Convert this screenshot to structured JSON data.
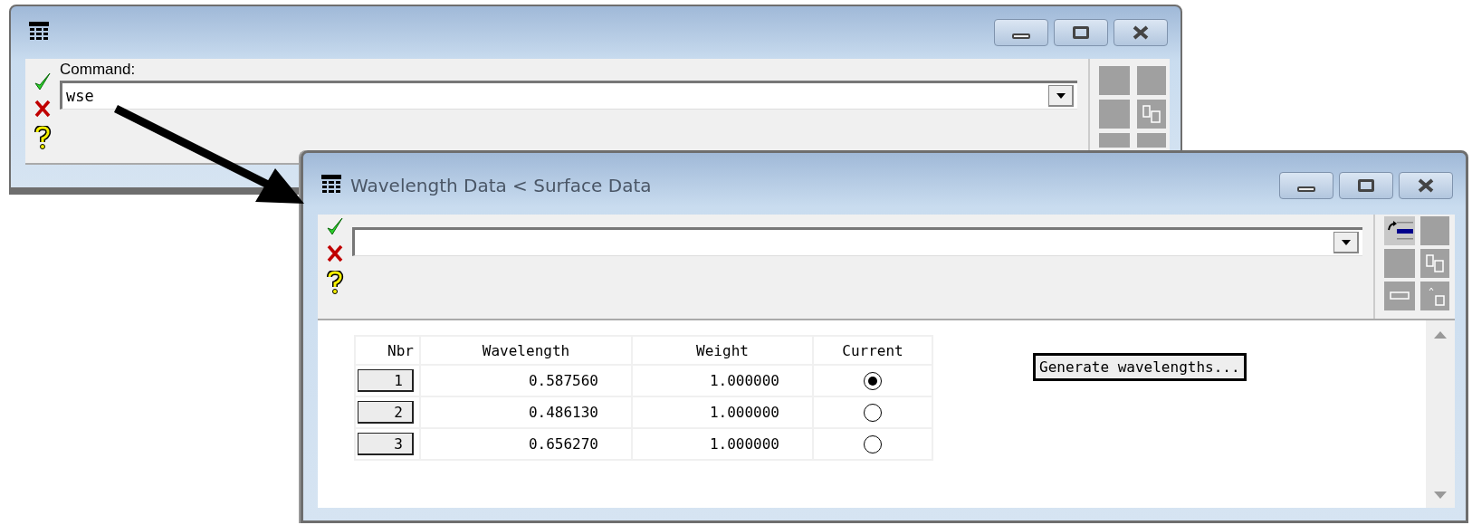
{
  "command_window": {
    "label": "Command:",
    "value": "wse"
  },
  "data_window": {
    "title": "Wavelength Data < Surface Data",
    "table": {
      "columns": [
        "Nbr",
        "Wavelength",
        "Weight",
        "Current"
      ],
      "rows": [
        {
          "nbr": "1",
          "wavelength": "0.587560",
          "weight": "1.000000",
          "selected": true
        },
        {
          "nbr": "2",
          "wavelength": "0.486130",
          "weight": "1.000000",
          "selected": false
        },
        {
          "nbr": "3",
          "wavelength": "0.656270",
          "weight": "1.000000",
          "selected": false
        }
      ]
    },
    "generate_button": "Generate wavelengths..."
  }
}
